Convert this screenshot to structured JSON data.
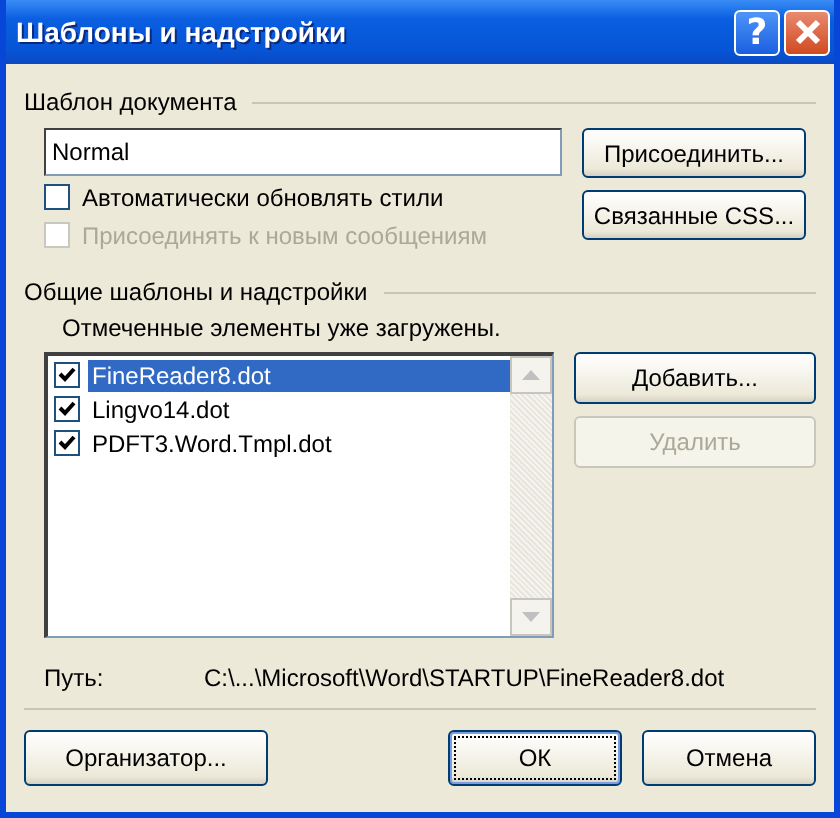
{
  "window": {
    "title": "Шаблоны и надстройки",
    "help_button": "?"
  },
  "document_template": {
    "heading": "Шаблон документа",
    "value": "Normal",
    "attach_button": "Присоединить...",
    "css_button": "Связанные CSS...",
    "options": [
      {
        "label": "Автоматически обновлять стили",
        "checked": false,
        "disabled": false
      },
      {
        "label": "Присоединять к новым сообщениям",
        "checked": false,
        "disabled": true
      }
    ]
  },
  "global_templates": {
    "heading": "Общие шаблоны и надстройки",
    "note": "Отмеченные элементы уже загружены.",
    "items": [
      {
        "label": "FineReader8.dot",
        "checked": true,
        "selected": true
      },
      {
        "label": "Lingvo14.dot",
        "checked": true,
        "selected": false
      },
      {
        "label": "PDFT3.Word.Tmpl.dot",
        "checked": true,
        "selected": false
      }
    ],
    "buttons": [
      {
        "label": "Добавить...",
        "disabled": false
      },
      {
        "label": "Удалить",
        "disabled": true
      }
    ]
  },
  "path": {
    "label": "Путь:",
    "value": "C:\\...\\Microsoft\\Word\\STARTUP\\FineReader8.dot"
  },
  "footer_buttons": [
    {
      "label": "Организатор...",
      "default": false
    },
    {
      "label": "ОК",
      "default": true
    },
    {
      "label": "Отмена",
      "default": false
    }
  ]
}
